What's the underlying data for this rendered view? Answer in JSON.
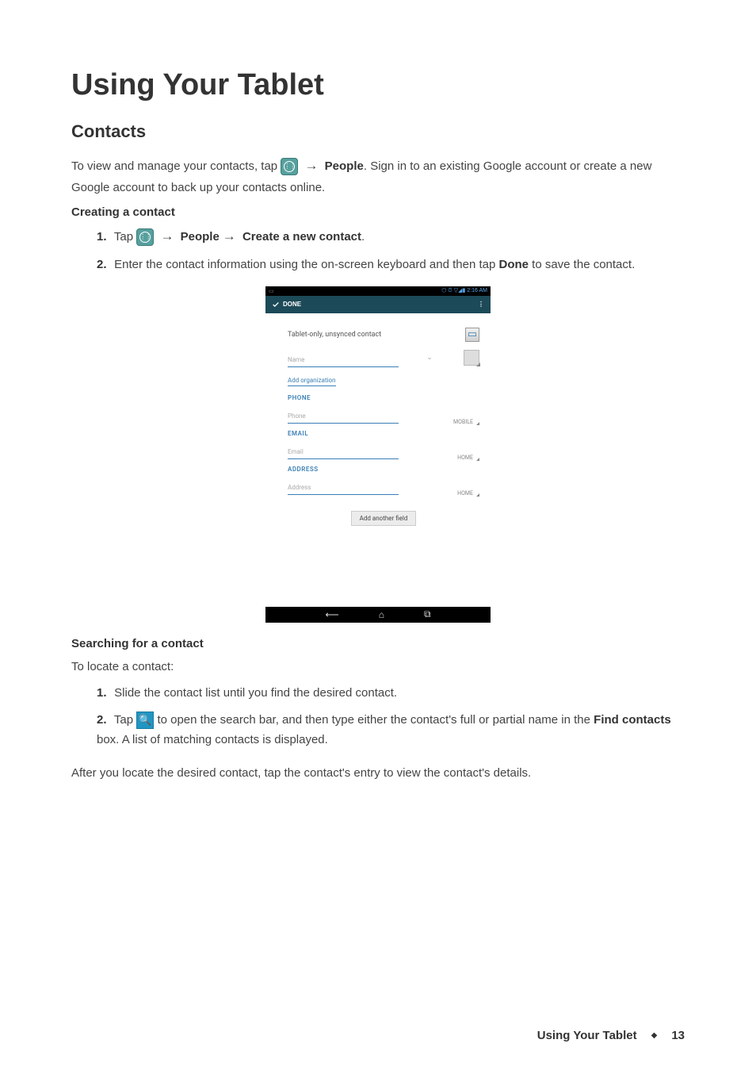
{
  "page": {
    "title": "Using Your Tablet",
    "section": "Contacts",
    "intro_before": "To view and manage your contacts, tap ",
    "intro_people": "People",
    "intro_after": ". Sign in to an existing Google account or create a new Google account to back up your contacts online.",
    "creating_heading": "Creating a contact",
    "step1": {
      "number": "1.",
      "text_before": "Tap ",
      "arrow": "→",
      "people": "People",
      "arrow2": "→",
      "create": "Create a new contact",
      "period": "."
    },
    "step2": {
      "number": "2.",
      "text_before": "Enter the contact information using the on-screen keyboard and then tap ",
      "done": "Done",
      "text_after": " to save the contact."
    },
    "searching_heading": "Searching for a contact",
    "searching_intro": "To locate a contact:",
    "search_step1": {
      "number": "1.",
      "text": "Slide the contact list until you find the desired contact."
    },
    "search_step2": {
      "number": "2.",
      "text_before": "Tap ",
      "text_mid": " to open the search bar, and then type either the contact's full or partial name in the ",
      "find": "Find contacts",
      "text_after": " box. A list of matching contacts is displayed."
    },
    "after_text": "After you locate the desired contact, tap the contact's entry to view the contact's details."
  },
  "screenshot": {
    "statusbar": {
      "time": "2:16 AM",
      "icons": "⬡ ⏱ ▽◢▮"
    },
    "done_label": "DONE",
    "overflow": "⋮",
    "account_type": "Tablet-only, unsynced contact",
    "name_placeholder": "Name",
    "add_org": "Add organization",
    "phone_section": "PHONE",
    "phone_placeholder": "Phone",
    "phone_type": "MOBILE",
    "email_section": "EMAIL",
    "email_placeholder": "Email",
    "email_type": "HOME",
    "address_section": "ADDRESS",
    "address_placeholder": "Address",
    "address_type": "HOME",
    "add_another": "Add another field"
  },
  "footer": {
    "title": "Using Your Tablet",
    "page": "13"
  }
}
